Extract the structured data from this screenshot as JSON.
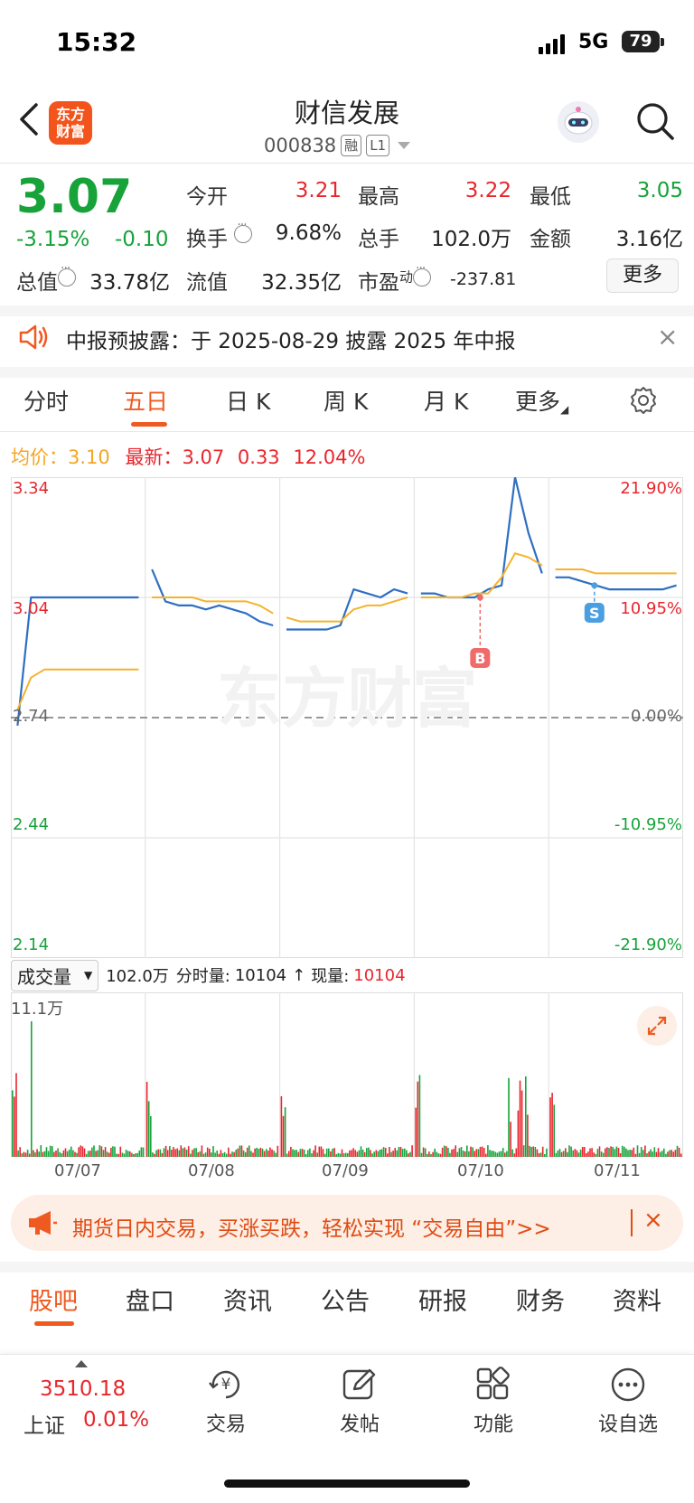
{
  "status_bar": {
    "time": "15:32",
    "network": "5G",
    "battery": "79"
  },
  "header": {
    "logo_text_line1": "东方",
    "logo_text_line2": "财富",
    "stock_name": "财信发展",
    "stock_code": "000838",
    "tag_margin": "融",
    "tag_level": "L1"
  },
  "quote": {
    "price": "3.07",
    "change_pct": "-3.15%",
    "change": "-0.10",
    "open_label": "今开",
    "open": "3.21",
    "high_label": "最高",
    "high": "3.22",
    "low_label": "最低",
    "low": "3.05",
    "turnover_label": "换手",
    "turnover": "9.68%",
    "volume_label": "总手",
    "volume": "102.0万",
    "amount_label": "金额",
    "amount": "3.16亿",
    "mktcap_label": "总值",
    "mktcap": "33.78亿",
    "float_label": "流值",
    "float": "32.35亿",
    "pe_label": "市盈",
    "pe_sup": "动",
    "pe": "-237.81",
    "more_label": "更多"
  },
  "notice": {
    "text": "中报预披露：于 2025-08-29 披露 2025 年中报",
    "close": "×"
  },
  "chart_tabs": [
    {
      "label": "分时"
    },
    {
      "label": "五日",
      "active": true
    },
    {
      "label": "日 K"
    },
    {
      "label": "周 K"
    },
    {
      "label": "月 K"
    },
    {
      "label": "更多"
    }
  ],
  "info": {
    "avg_label": "均价：",
    "avg": "3.10",
    "latest_label": "最新：",
    "latest": "3.07",
    "latest_abs": "0.33",
    "latest_pct": "12.04%"
  },
  "watermark": "东方财富",
  "colors": {
    "accent": "#ef5a21",
    "up": "#e8262d",
    "down": "#17a33a",
    "price_line": "#2f6fc2",
    "avg_line": "#f5b22e"
  },
  "chart_data": {
    "type": "line",
    "x": [
      "07/07",
      "07/08",
      "07/09",
      "07/10",
      "07/11"
    ],
    "y_left_ticks": [
      "3.34",
      "3.04",
      "2.74",
      "2.44",
      "2.14"
    ],
    "y_right_ticks": [
      "21.90%",
      "10.95%",
      "0.00%",
      "-10.95%",
      "-21.90%"
    ],
    "ylim": [
      2.14,
      3.34
    ],
    "baseline": 2.74,
    "series": [
      {
        "values": [
          2.72,
          3.04,
          3.04,
          3.04,
          3.04,
          3.04,
          3.04,
          3.04,
          3.04,
          3.04,
          3.11,
          3.03,
          3.02,
          3.02,
          3.01,
          3.02,
          3.01,
          3.0,
          2.98,
          2.97,
          2.96,
          2.96,
          2.96,
          2.96,
          2.97,
          3.06,
          3.05,
          3.04,
          3.06,
          3.05,
          3.05,
          3.05,
          3.04,
          3.04,
          3.04,
          3.06,
          3.07,
          3.34,
          3.2,
          3.1,
          3.09,
          3.09,
          3.08,
          3.07,
          3.06,
          3.06,
          3.06,
          3.06,
          3.06,
          3.07
        ]
      },
      {
        "values": [
          2.76,
          2.84,
          2.86,
          2.86,
          2.86,
          2.86,
          2.86,
          2.86,
          2.86,
          2.86,
          3.04,
          3.04,
          3.04,
          3.04,
          3.03,
          3.03,
          3.03,
          3.03,
          3.02,
          3.0,
          2.99,
          2.98,
          2.98,
          2.98,
          2.98,
          3.01,
          3.02,
          3.02,
          3.03,
          3.04,
          3.04,
          3.04,
          3.04,
          3.04,
          3.05,
          3.05,
          3.09,
          3.15,
          3.14,
          3.12,
          3.11,
          3.11,
          3.11,
          3.1,
          3.1,
          3.1,
          3.1,
          3.1,
          3.1,
          3.1
        ]
      }
    ],
    "markers": [
      {
        "label": "B"
      },
      {
        "label": "S"
      }
    ],
    "volume": {
      "label": "成交量",
      "total": "102.0万",
      "minute_label": "分时量:",
      "minute": "10104",
      "arrow": "↑",
      "current_label": "现量:",
      "current": "10104",
      "max_label": "11.1万"
    }
  },
  "promo": {
    "text": "期货日内交易，买涨买跌，轻松实现 “交易自由”>>",
    "close": "×"
  },
  "bottom_tabs": [
    "股吧",
    "盘口",
    "资讯",
    "公告",
    "研报",
    "财务",
    "资料"
  ],
  "bottom_bar": {
    "index_value": "3510.18",
    "index_name": "上证",
    "index_pct": "0.01%",
    "items": [
      {
        "label": "交易",
        "icon": "trade-icon"
      },
      {
        "label": "发帖",
        "icon": "post-icon"
      },
      {
        "label": "功能",
        "icon": "apps-icon"
      },
      {
        "label": "设自选",
        "icon": "more-icon"
      }
    ]
  }
}
